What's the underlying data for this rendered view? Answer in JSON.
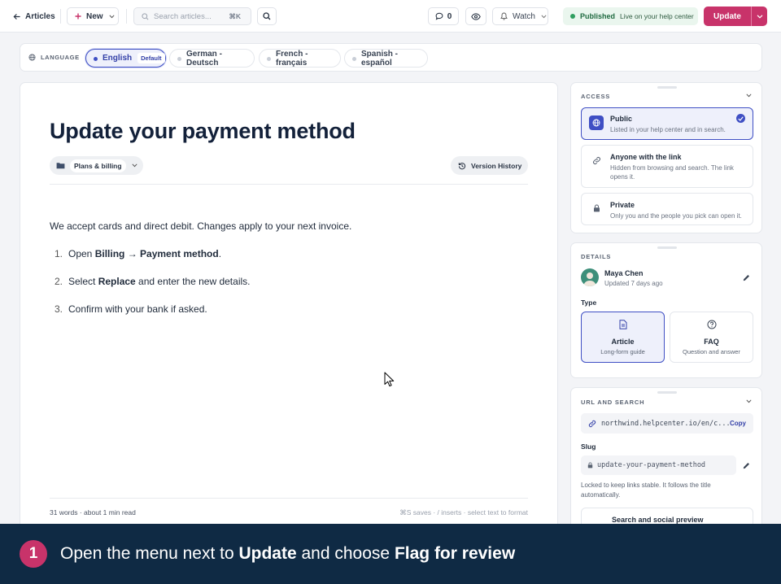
{
  "topbar": {
    "back_label": "Articles",
    "new_label": "New",
    "search_placeholder": "Search articles...",
    "search_shortcut": "⌘K",
    "comments_count": "0",
    "watch_label": "Watch",
    "status_label": "Published",
    "status_detail": "Live on your help center",
    "update_label": "Update"
  },
  "language": {
    "label": "LANGUAGE",
    "items": [
      {
        "label": "English",
        "badge": "Default"
      },
      {
        "label": "German - Deutsch"
      },
      {
        "label": "French - français"
      },
      {
        "label": "Spanish - español"
      }
    ]
  },
  "article": {
    "title": "Update your payment method",
    "category": "Plans & billing",
    "version_history_label": "Version History",
    "intro": "We accept cards and direct debit. Changes apply to your next invoice.",
    "steps": [
      {
        "num": "1.",
        "pre": "Open ",
        "bold": "Billing → Payment method",
        "post": "."
      },
      {
        "num": "2.",
        "pre": "Select ",
        "bold": "Replace",
        "post": " and enter the new details."
      },
      {
        "num": "3.",
        "pre": "Confirm with your bank if asked.",
        "bold": "",
        "post": ""
      }
    ],
    "footer_stats": "31 words · about 1 min read",
    "footer_hint": "⌘S saves · / inserts · select text to format"
  },
  "access": {
    "title": "ACCESS",
    "options": [
      {
        "title": "Public",
        "desc": "Listed in your help center and in search."
      },
      {
        "title": "Anyone with the link",
        "desc": "Hidden from browsing and search. The link opens it."
      },
      {
        "title": "Private",
        "desc": "Only you and the people you pick can open it."
      }
    ]
  },
  "details": {
    "title": "DETAILS",
    "author": "Maya Chen",
    "updated": "Updated 7 days ago",
    "type_label": "Type",
    "types": [
      {
        "title": "Article",
        "desc": "Long-form guide"
      },
      {
        "title": "FAQ",
        "desc": "Question and answer"
      }
    ]
  },
  "url": {
    "title": "URL AND SEARCH",
    "url_value": "northwind.helpcenter.io/en/c...",
    "copy_label": "Copy",
    "slug_label": "Slug",
    "slug_value": "update-your-payment-method",
    "slug_note": "Locked to keep links stable. It follows the title automatically.",
    "preview_label": "Search and social preview"
  },
  "instruction": {
    "step": "1",
    "pre": "Open the menu next to ",
    "bold1": "Update",
    "mid": " and choose ",
    "bold2": "Flag for review"
  },
  "colors": {
    "accent": "#3f4fc4",
    "brand": "#c8336a",
    "published": "#2f9e5f",
    "banner": "#0f2a44"
  }
}
